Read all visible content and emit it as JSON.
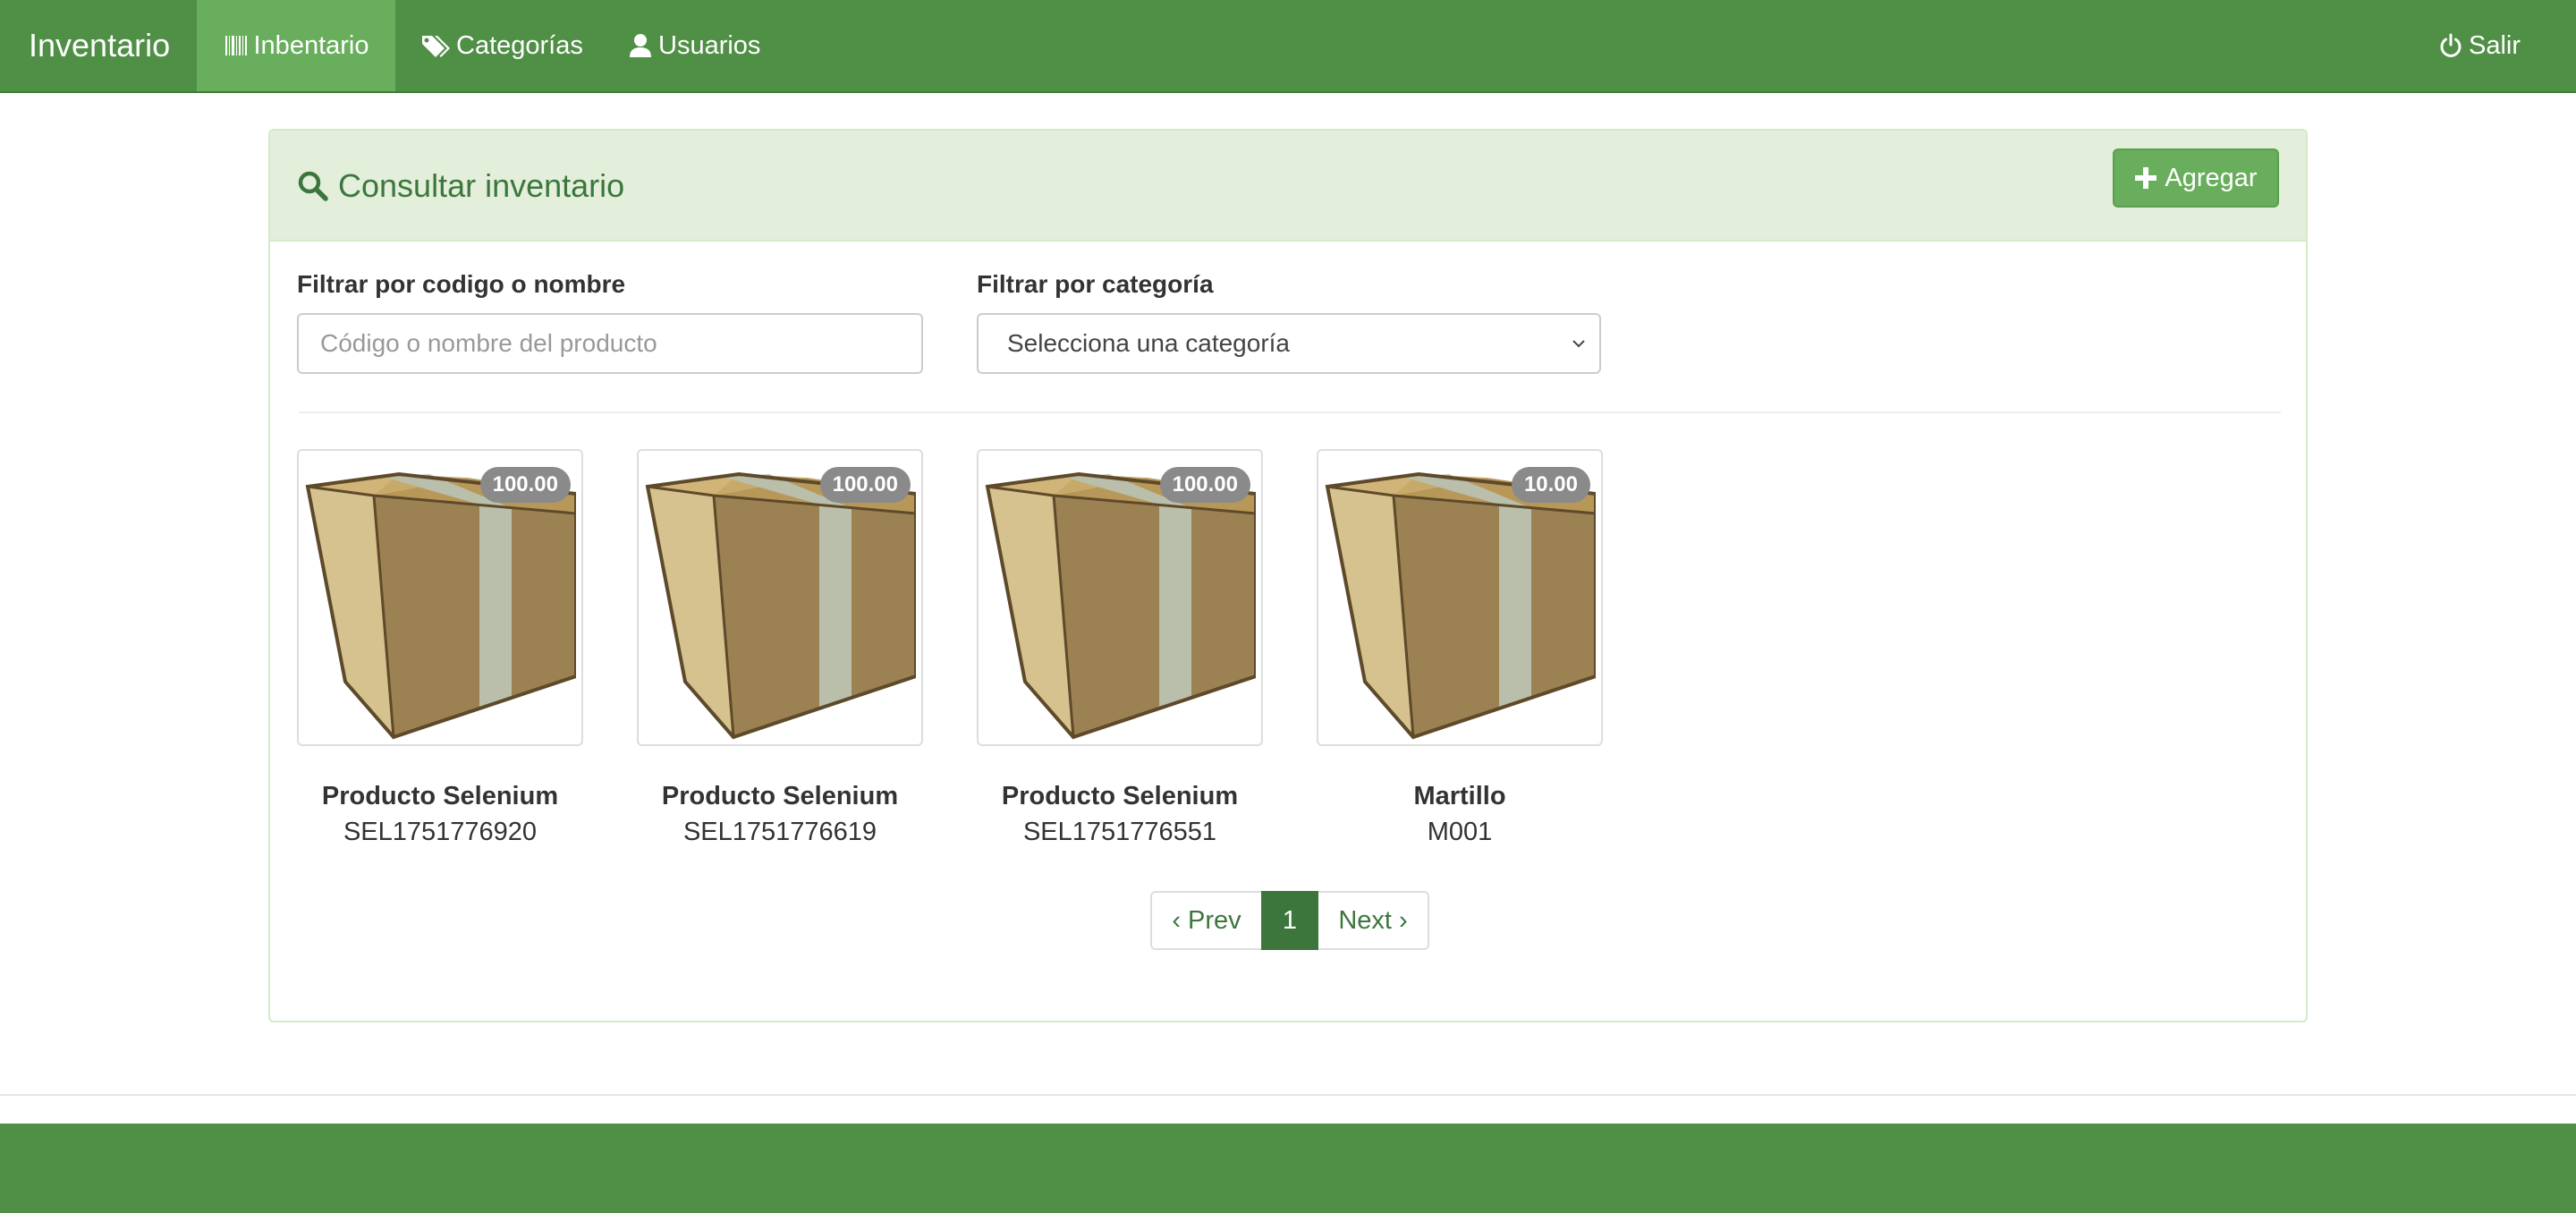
{
  "navbar": {
    "brand": "Inventario",
    "items": [
      {
        "label": "Inbentario",
        "icon": "barcode-icon",
        "active": true
      },
      {
        "label": "Categorías",
        "icon": "tags-icon",
        "active": false
      },
      {
        "label": "Usuarios",
        "icon": "user-icon",
        "active": false
      }
    ],
    "logout_label": "Salir",
    "logout_icon": "power-icon"
  },
  "panel": {
    "title": "Consultar inventario",
    "title_icon": "search-icon",
    "add_button": "Agregar"
  },
  "filters": {
    "code_label": "Filtrar por codigo o nombre",
    "code_placeholder": "Código o nombre del producto",
    "category_label": "Filtrar por categoría",
    "category_selected": "Selecciona una categoría"
  },
  "products": [
    {
      "name": "Producto Selenium",
      "code": "SEL1751776920",
      "quantity": "100.00"
    },
    {
      "name": "Producto Selenium",
      "code": "SEL1751776619",
      "quantity": "100.00"
    },
    {
      "name": "Producto Selenium",
      "code": "SEL1751776551",
      "quantity": "100.00"
    },
    {
      "name": "Martillo",
      "code": "M001",
      "quantity": "10.00"
    }
  ],
  "pagination": {
    "prev": "‹ Prev",
    "current": "1",
    "next": "Next ›"
  },
  "colors": {
    "navbar": "#508f46",
    "nav_active": "#68ae5c",
    "panel_heading": "#e3efdb",
    "accent_text": "#3c763d",
    "badge": "#8a8a8a"
  }
}
